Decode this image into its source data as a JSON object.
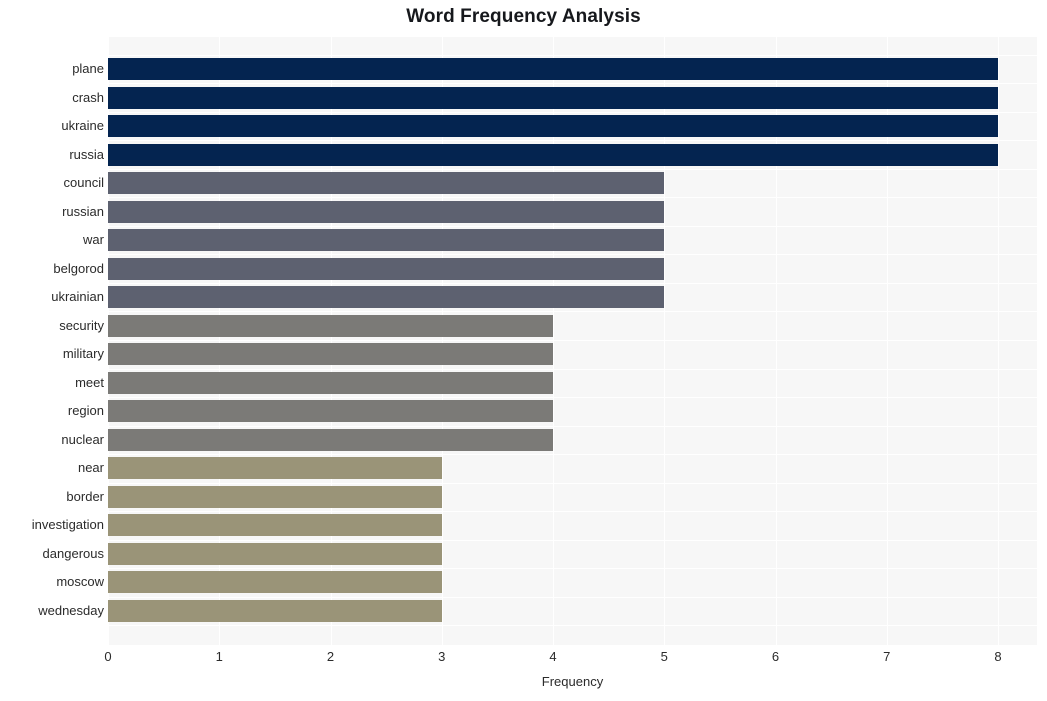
{
  "chart_data": {
    "type": "bar",
    "orientation": "horizontal",
    "title": "Word Frequency Analysis",
    "xlabel": "Frequency",
    "ylabel": "",
    "xlim": [
      0,
      8.35
    ],
    "xticks": [
      0,
      1,
      2,
      3,
      4,
      5,
      6,
      7,
      8
    ],
    "xticklabels": [
      "0",
      "1",
      "2",
      "3",
      "4",
      "5",
      "6",
      "7",
      "8"
    ],
    "grid": true,
    "legend": "none",
    "categories": [
      "plane",
      "crash",
      "ukraine",
      "russia",
      "council",
      "russian",
      "war",
      "belgorod",
      "ukrainian",
      "security",
      "military",
      "meet",
      "region",
      "nuclear",
      "near",
      "border",
      "investigation",
      "dangerous",
      "moscow",
      "wednesday"
    ],
    "values": [
      8,
      8,
      8,
      8,
      5,
      5,
      5,
      5,
      5,
      4,
      4,
      4,
      4,
      4,
      3,
      3,
      3,
      3,
      3,
      3
    ],
    "bar_colors": [
      "#042450",
      "#042450",
      "#042450",
      "#042450",
      "#5d6170",
      "#5d6170",
      "#5d6170",
      "#5d6170",
      "#5d6170",
      "#7b7a77",
      "#7b7a77",
      "#7b7a77",
      "#7b7a77",
      "#7b7a77",
      "#9a9478",
      "#9a9478",
      "#9a9478",
      "#9a9478",
      "#9a9478",
      "#9a9478"
    ],
    "palette": {
      "navy": "#042450",
      "slate": "#5d6170",
      "gray": "#7b7a77",
      "khaki": "#9a9478",
      "plot_background": "#f7f7f7",
      "gridline": "#ffffff",
      "figure_background": "#ffffff",
      "text": "#2b2b2b",
      "title_text": "#16181c"
    }
  }
}
